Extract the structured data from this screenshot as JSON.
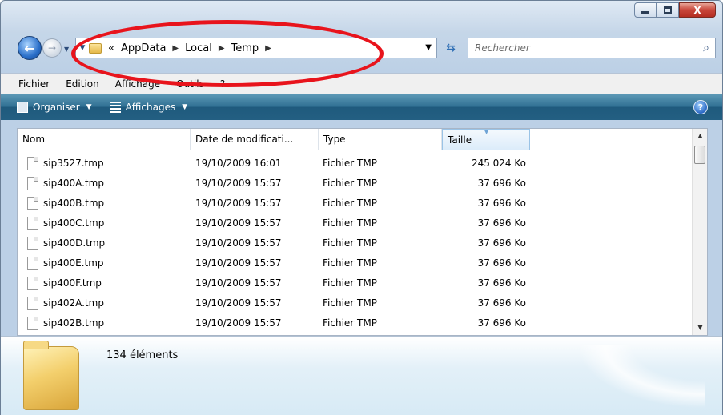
{
  "window": {
    "minimize_icon": "minimize-icon",
    "maximize_icon": "maximize-icon",
    "close_label": "X"
  },
  "nav": {
    "back_glyph": "←",
    "forward_glyph": "→",
    "address": {
      "overflow": "«",
      "crumbs": [
        "AppData",
        "Local",
        "Temp"
      ]
    },
    "refresh_glyph": "⇆",
    "search_placeholder": "Rechercher"
  },
  "menu": [
    "Fichier",
    "Edition",
    "Affichage",
    "Outils",
    "?"
  ],
  "toolbar": {
    "organize_label": "Organiser",
    "views_label": "Affichages",
    "help_glyph": "?"
  },
  "columns": [
    "Nom",
    "Date de modificati...",
    "Type",
    "Taille"
  ],
  "sorted_column": "Taille",
  "files": [
    {
      "name": "sip3527.tmp",
      "date": "19/10/2009 16:01",
      "type": "Fichier TMP",
      "size": "245 024 Ko"
    },
    {
      "name": "sip400A.tmp",
      "date": "19/10/2009 15:57",
      "type": "Fichier TMP",
      "size": "37 696 Ko"
    },
    {
      "name": "sip400B.tmp",
      "date": "19/10/2009 15:57",
      "type": "Fichier TMP",
      "size": "37 696 Ko"
    },
    {
      "name": "sip400C.tmp",
      "date": "19/10/2009 15:57",
      "type": "Fichier TMP",
      "size": "37 696 Ko"
    },
    {
      "name": "sip400D.tmp",
      "date": "19/10/2009 15:57",
      "type": "Fichier TMP",
      "size": "37 696 Ko"
    },
    {
      "name": "sip400E.tmp",
      "date": "19/10/2009 15:57",
      "type": "Fichier TMP",
      "size": "37 696 Ko"
    },
    {
      "name": "sip400F.tmp",
      "date": "19/10/2009 15:57",
      "type": "Fichier TMP",
      "size": "37 696 Ko"
    },
    {
      "name": "sip402A.tmp",
      "date": "19/10/2009 15:57",
      "type": "Fichier TMP",
      "size": "37 696 Ko"
    },
    {
      "name": "sip402B.tmp",
      "date": "19/10/2009 15:57",
      "type": "Fichier TMP",
      "size": "37 696 Ko"
    }
  ],
  "details": {
    "count_text": "134 éléments"
  },
  "colors": {
    "annotation": "#e8141c",
    "command_bar": "#2f6f92"
  }
}
